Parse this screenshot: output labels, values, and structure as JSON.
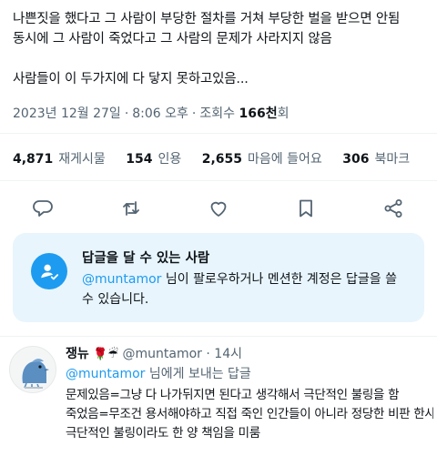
{
  "tweet": {
    "lines": [
      "나쁜짓을 했다고 그 사람이 부당한 절차를 거쳐 부당한 벌을 받으면 안됨",
      "동시에 그 사람이 죽었다고 그 사람의 문제가 사라지지 않음",
      "",
      "사람들이 이 두가지에 다 닿지 못하고있음..."
    ],
    "date": "2023년 12월 27일",
    "time": "8:06 오후",
    "views_label": "조회수",
    "views": "166천",
    "views_suffix": "회"
  },
  "stats": [
    {
      "num": "4,871",
      "label": "재게시물"
    },
    {
      "num": "154",
      "label": "인용"
    },
    {
      "num": "2,655",
      "label": "마음에 들어요"
    },
    {
      "num": "306",
      "label": "북마크"
    }
  ],
  "actions": [
    "reply-icon",
    "repost-icon",
    "like-icon",
    "bookmark-icon",
    "share-icon"
  ],
  "who_can_reply": {
    "title": "답글을 달 수 있는 사람",
    "mention": "@muntamor",
    "text": " 님이 팔로우하거나 멘션한 계정은 답글을 쓸 수 있습니다."
  },
  "reply": {
    "name": "쟁뉴",
    "emoji": "🌹☔",
    "handle": "@muntamor",
    "time": "14시",
    "replying_to": "@muntamor",
    "replying_suffix": " 님에게 보내는 답글",
    "lines": [
      "문제있음=그냥 다 나가뒤지면 된다고 생각해서 극단적인 불링을 함",
      "죽었음=무조건 용서해야하고 직접 죽인 인간들이 아니라 정당한 비판 한사람들한테",
      "극단적인 불링이라도 한 양 책임을 미룸"
    ]
  },
  "colors": {
    "accent": "#1d9bf0",
    "secondary_text": "#536471",
    "card_bg": "#e8f5fd"
  }
}
